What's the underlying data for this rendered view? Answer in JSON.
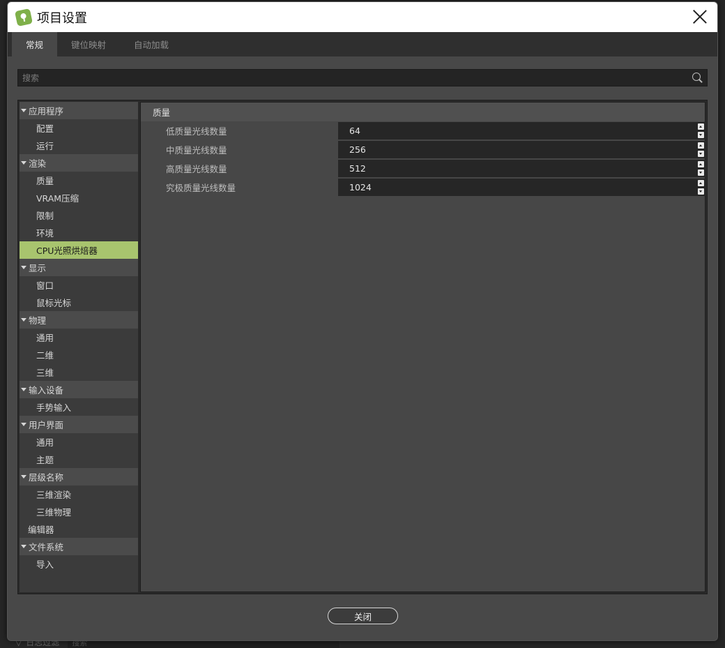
{
  "window": {
    "title": "项目设置"
  },
  "tabs": [
    {
      "label": "常规",
      "active": true
    },
    {
      "label": "键位映射",
      "active": false
    },
    {
      "label": "自动加载",
      "active": false
    }
  ],
  "search": {
    "placeholder": "搜索"
  },
  "sidebar": {
    "items": [
      {
        "label": "应用程序",
        "kind": "section"
      },
      {
        "label": "配置",
        "kind": "child"
      },
      {
        "label": "运行",
        "kind": "child"
      },
      {
        "label": "渲染",
        "kind": "section"
      },
      {
        "label": "质量",
        "kind": "child"
      },
      {
        "label": "VRAM压缩",
        "kind": "child"
      },
      {
        "label": "限制",
        "kind": "child"
      },
      {
        "label": "环境",
        "kind": "child"
      },
      {
        "label": "CPU光照烘焙器",
        "kind": "child",
        "selected": true
      },
      {
        "label": "显示",
        "kind": "section"
      },
      {
        "label": "窗口",
        "kind": "child"
      },
      {
        "label": "鼠标光标",
        "kind": "child"
      },
      {
        "label": "物理",
        "kind": "section"
      },
      {
        "label": "通用",
        "kind": "child"
      },
      {
        "label": "二维",
        "kind": "child"
      },
      {
        "label": "三维",
        "kind": "child"
      },
      {
        "label": "输入设备",
        "kind": "section"
      },
      {
        "label": "手势输入",
        "kind": "child"
      },
      {
        "label": "用户界面",
        "kind": "section"
      },
      {
        "label": "通用",
        "kind": "child"
      },
      {
        "label": "主题",
        "kind": "child"
      },
      {
        "label": "层级名称",
        "kind": "section"
      },
      {
        "label": "三维渲染",
        "kind": "child"
      },
      {
        "label": "三维物理",
        "kind": "child"
      },
      {
        "label": "编辑器",
        "kind": "leaf"
      },
      {
        "label": "文件系统",
        "kind": "section"
      },
      {
        "label": "导入",
        "kind": "child"
      }
    ]
  },
  "main": {
    "section_title": "质量",
    "properties": [
      {
        "label": "低质量光线数量",
        "value": "64"
      },
      {
        "label": "中质量光线数量",
        "value": "256"
      },
      {
        "label": "高质量光线数量",
        "value": "512"
      },
      {
        "label": "究极质量光线数量",
        "value": "1024"
      }
    ]
  },
  "footer": {
    "close_label": "关闭"
  },
  "background": {
    "filter_label": "日志过滤",
    "search_placeholder": "搜索"
  },
  "colors": {
    "selected": "#a8c46e",
    "accent_icon": "#7fb04a"
  }
}
